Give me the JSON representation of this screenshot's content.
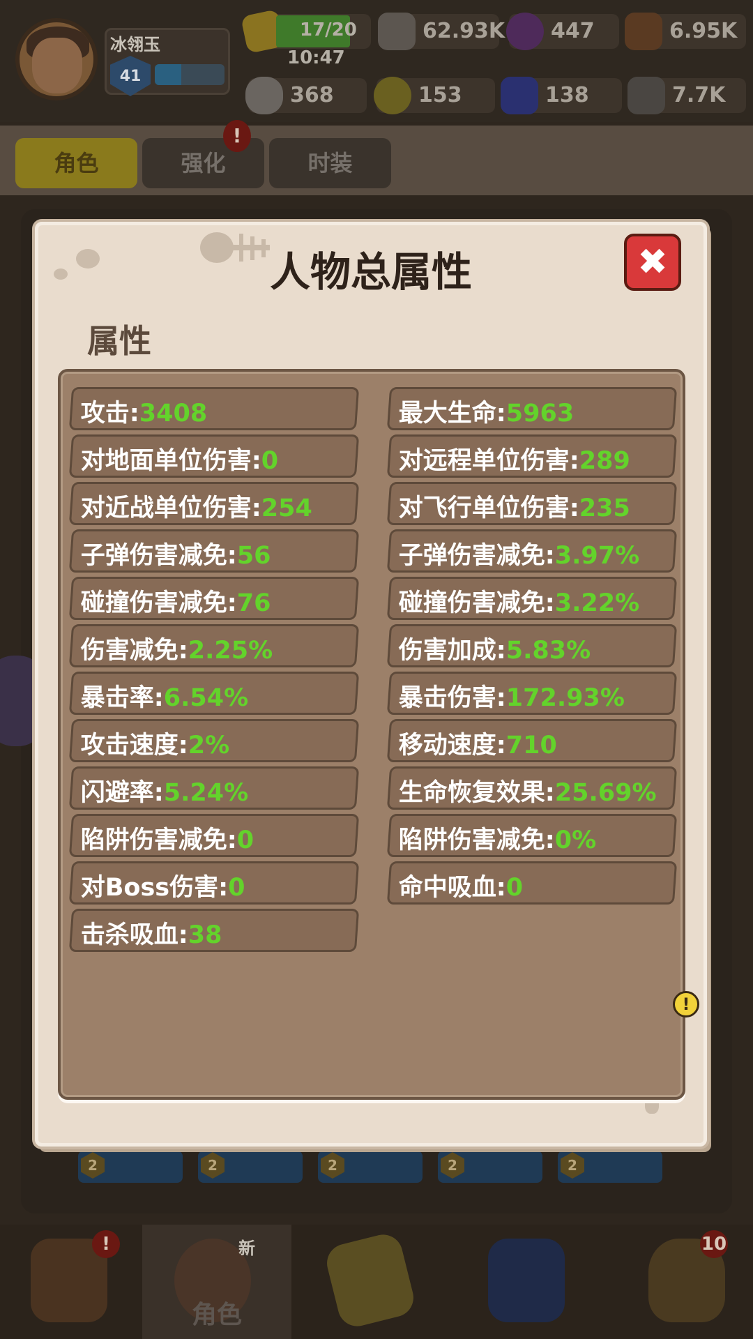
{
  "player": {
    "name": "冰翎玉",
    "level": "41"
  },
  "resources": {
    "energy": "17/20",
    "energy_timer": "10:47",
    "items": [
      {
        "icon": "stone-coin-icon",
        "value": "62.93K"
      },
      {
        "icon": "purple-gem-icon",
        "value": "447"
      },
      {
        "icon": "wood-logs-icon",
        "value": "6.95K"
      },
      {
        "icon": "bone-icon",
        "value": "368"
      },
      {
        "icon": "egg-icon",
        "value": "153"
      },
      {
        "icon": "crystal-icon",
        "value": "138"
      },
      {
        "icon": "iron-ore-icon",
        "value": "7.7K"
      }
    ]
  },
  "bg_tabs": [
    "角色",
    "强化",
    "时装"
  ],
  "bg_slot_levels": [
    "2",
    "2",
    "2",
    "2",
    "2"
  ],
  "bottom_nav": {
    "active_label": "角色",
    "new_badge": "新",
    "bag_count": "10",
    "alert": "!"
  },
  "modal": {
    "title": "人物总属性",
    "section": "属性",
    "close_icon": "close-icon",
    "warning_mark": "!"
  },
  "attributes": [
    {
      "label": "攻击:",
      "value": "3408"
    },
    {
      "label": "最大生命:",
      "value": "5963"
    },
    {
      "label": "对地面单位伤害:",
      "value": "0"
    },
    {
      "label": "对远程单位伤害:",
      "value": "289"
    },
    {
      "label": "对近战单位伤害:",
      "value": "254"
    },
    {
      "label": "对飞行单位伤害:",
      "value": "235"
    },
    {
      "label": "子弹伤害减免:",
      "value": "56"
    },
    {
      "label": "子弹伤害减免:",
      "value": "3.97%"
    },
    {
      "label": "碰撞伤害减免:",
      "value": "76"
    },
    {
      "label": "碰撞伤害减免:",
      "value": "3.22%"
    },
    {
      "label": "伤害减免:",
      "value": "2.25%"
    },
    {
      "label": "伤害加成:",
      "value": "5.83%"
    },
    {
      "label": "暴击率:",
      "value": "6.54%"
    },
    {
      "label": "暴击伤害:",
      "value": "172.93%"
    },
    {
      "label": "攻击速度:",
      "value": "2%"
    },
    {
      "label": "移动速度:",
      "value": "710"
    },
    {
      "label": "闪避率:",
      "value": "5.24%"
    },
    {
      "label": "生命恢复效果:",
      "value": "25.69%"
    },
    {
      "label": "陷阱伤害减免:",
      "value": "0"
    },
    {
      "label": "陷阱伤害减免:",
      "value": "0%"
    },
    {
      "label": "对Boss伤害:",
      "value": "0"
    },
    {
      "label": "命中吸血:",
      "value": "0"
    },
    {
      "label": "击杀吸血:",
      "value": "38"
    }
  ],
  "colors": {
    "value_green": "#63d32b",
    "close_red": "#d9393a",
    "panel_brown": "#9c8069",
    "parchment": "#e9dccd"
  }
}
